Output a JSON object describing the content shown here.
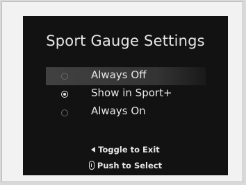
{
  "screen": {
    "title": "Sport Gauge Settings",
    "options": [
      {
        "label": "Always Off",
        "selected": false,
        "highlighted": true
      },
      {
        "label": "Show in Sport+",
        "selected": true,
        "highlighted": false
      },
      {
        "label": "Always On",
        "selected": false,
        "highlighted": false
      }
    ],
    "hints": {
      "exit": {
        "icon": "left-triangle-icon",
        "label": "Toggle to Exit"
      },
      "select": {
        "icon": "push-knob-icon",
        "label": "Push to Select"
      }
    }
  },
  "colors": {
    "screen_background": "#121212",
    "text": "#e6e6e6",
    "highlight": "#464646",
    "frame": "#f2f2f2"
  }
}
